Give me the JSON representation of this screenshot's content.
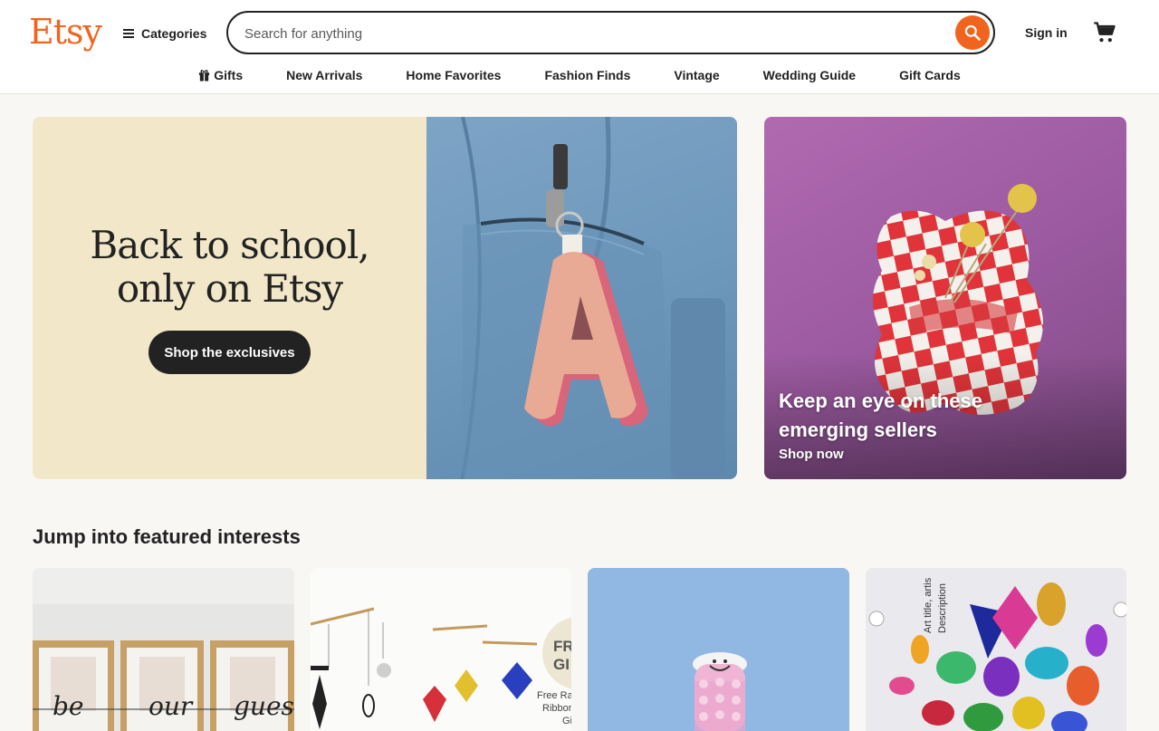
{
  "brand": {
    "logo_text": "Etsy",
    "accent": "#f1641e"
  },
  "header": {
    "categories_label": "Categories",
    "search_placeholder": "Search for anything",
    "sign_in_label": "Sign in"
  },
  "nav": {
    "items": [
      "Gifts",
      "New Arrivals",
      "Home Favorites",
      "Fashion Finds",
      "Vintage",
      "Wedding Guide",
      "Gift Cards"
    ]
  },
  "hero": {
    "title_line1": "Back to school,",
    "title_line2": "only on Etsy",
    "button_label": "Shop the exclusives",
    "background": "#f2e8c9"
  },
  "promo": {
    "title": "Keep an eye on these emerging sellers",
    "link_label": "Shop now"
  },
  "featured": {
    "title": "Jump into featured interests",
    "card_partial_text": [
      "be",
      "our",
      "guest"
    ],
    "card2_partial_text": [
      "FR",
      "GI",
      "Free Ra",
      "Ribbor",
      "Gi"
    ],
    "card4_partial_text": [
      "Art title, artis",
      "Description"
    ]
  }
}
